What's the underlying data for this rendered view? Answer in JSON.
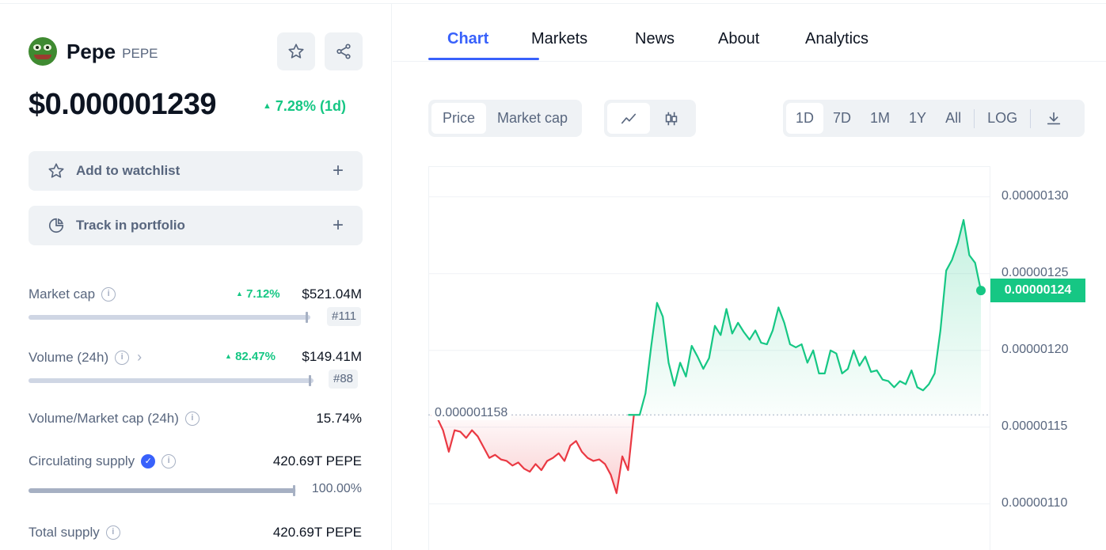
{
  "coin": {
    "name": "Pepe",
    "symbol": "PEPE",
    "price": "$0.000001239",
    "change": "7.28% (1d)",
    "change_color": "#16c784"
  },
  "actions": {
    "watchlist": "Add to watchlist",
    "portfolio": "Track in portfolio",
    "plus": "+"
  },
  "stats": {
    "market_cap": {
      "label": "Market cap",
      "pct": "7.12%",
      "value": "$521.04M",
      "rank": "#111"
    },
    "volume": {
      "label": "Volume (24h)",
      "pct": "82.47%",
      "value": "$149.41M",
      "rank": "#88"
    },
    "vol_mcap": {
      "label": "Volume/Market cap (24h)",
      "value": "15.74%"
    },
    "circ_supply": {
      "label": "Circulating supply",
      "value": "420.69T PEPE",
      "pct": "100.00%",
      "fill": 0.998
    },
    "total_supply": {
      "label": "Total supply",
      "value": "420.69T PEPE"
    }
  },
  "tabs": [
    "Chart",
    "Markets",
    "News",
    "About",
    "Analytics"
  ],
  "active_tab": "Chart",
  "chart_controls": {
    "metric": [
      "Price",
      "Market cap"
    ],
    "metric_selected": "Price",
    "style_selected": "line",
    "ranges": [
      "1D",
      "7D",
      "1M",
      "1Y",
      "All"
    ],
    "range_selected": "1D",
    "log": "LOG"
  },
  "chart_data": {
    "type": "line",
    "x": [
      0,
      1,
      2,
      3,
      4,
      5,
      6,
      7,
      8,
      9,
      10,
      11,
      12,
      13,
      14,
      15,
      16,
      17,
      18,
      19,
      20,
      21,
      22,
      23,
      24,
      25,
      26,
      27,
      28,
      29,
      30,
      31,
      32,
      33,
      34,
      35,
      36,
      37,
      38,
      39,
      40,
      41,
      42,
      43,
      44,
      45,
      46,
      47,
      48,
      49,
      50,
      51,
      52,
      53,
      54,
      55,
      56,
      57,
      58,
      59,
      60,
      61,
      62,
      63,
      64,
      65,
      66,
      67,
      68,
      69,
      70,
      71,
      72,
      73,
      74,
      75,
      76,
      77,
      78,
      79,
      80,
      81,
      82,
      83,
      84,
      85,
      86,
      87,
      88,
      89,
      90,
      91,
      92,
      93,
      94,
      95
    ],
    "values": [
      1.158e-06,
      1.156e-06,
      1.148e-06,
      1.134e-06,
      1.148e-06,
      1.147e-06,
      1.143e-06,
      1.148e-06,
      1.144e-06,
      1.137e-06,
      1.13e-06,
      1.132e-06,
      1.129e-06,
      1.128e-06,
      1.125e-06,
      1.127e-06,
      1.123e-06,
      1.121e-06,
      1.126e-06,
      1.122e-06,
      1.128e-06,
      1.13e-06,
      1.133e-06,
      1.128e-06,
      1.138e-06,
      1.141e-06,
      1.134e-06,
      1.13e-06,
      1.128e-06,
      1.129e-06,
      1.126e-06,
      1.119e-06,
      1.107e-06,
      1.131e-06,
      1.122e-06,
      1.158e-06,
      1.158e-06,
      1.172e-06,
      1.203e-06,
      1.231e-06,
      1.222e-06,
      1.192e-06,
      1.177e-06,
      1.192e-06,
      1.183e-06,
      1.203e-06,
      1.196e-06,
      1.188e-06,
      1.195e-06,
      1.216e-06,
      1.21e-06,
      1.227e-06,
      1.211e-06,
      1.218e-06,
      1.212e-06,
      1.207e-06,
      1.213e-06,
      1.205e-06,
      1.204e-06,
      1.213e-06,
      1.228e-06,
      1.218e-06,
      1.204e-06,
      1.202e-06,
      1.204e-06,
      1.192e-06,
      1.2e-06,
      1.185e-06,
      1.185e-06,
      1.2e-06,
      1.198e-06,
      1.185e-06,
      1.188e-06,
      1.2e-06,
      1.19e-06,
      1.196e-06,
      1.186e-06,
      1.187e-06,
      1.181e-06,
      1.18e-06,
      1.176e-06,
      1.18e-06,
      1.178e-06,
      1.187e-06,
      1.176e-06,
      1.174e-06,
      1.178e-06,
      1.185e-06,
      1.213e-06,
      1.252e-06,
      1.259e-06,
      1.27e-06,
      1.285e-06,
      1.262e-06,
      1.257e-06,
      1.239e-06
    ],
    "ylim": [
      1.07e-06,
      1.32e-06
    ],
    "yticks": [
      "0.00000130",
      "0.00000125",
      "0.00000120",
      "0.00000115",
      "0.00000110"
    ],
    "ytick_values": [
      1.3e-06,
      1.25e-06,
      1.2e-06,
      1.15e-06,
      1.1e-06
    ],
    "open_value": 1.158e-06,
    "open_label": "0.000001158",
    "current_label": "0.00000124",
    "up_color": "#16c784",
    "down_color": "#ea3943",
    "grid": true
  }
}
